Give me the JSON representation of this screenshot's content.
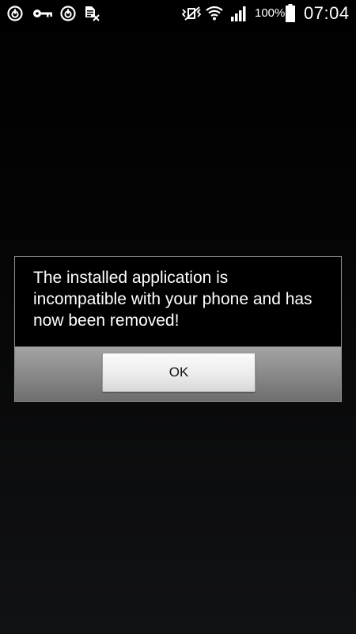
{
  "status_bar": {
    "notification_icons": [
      "power-icon",
      "key-icon",
      "power-icon",
      "sim-error-icon"
    ],
    "system_icons": [
      "vibrate-icon",
      "wifi-icon",
      "signal-icon",
      "battery-icon"
    ],
    "battery_percent": "100%",
    "time": "07:04"
  },
  "dialog": {
    "message": "The installed application is incompatible with your phone and has now been removed!",
    "ok_label": "OK"
  },
  "colors": {
    "background": "#000000",
    "dialog_footer": "#8a8a8a",
    "button_face": "#ececec"
  }
}
